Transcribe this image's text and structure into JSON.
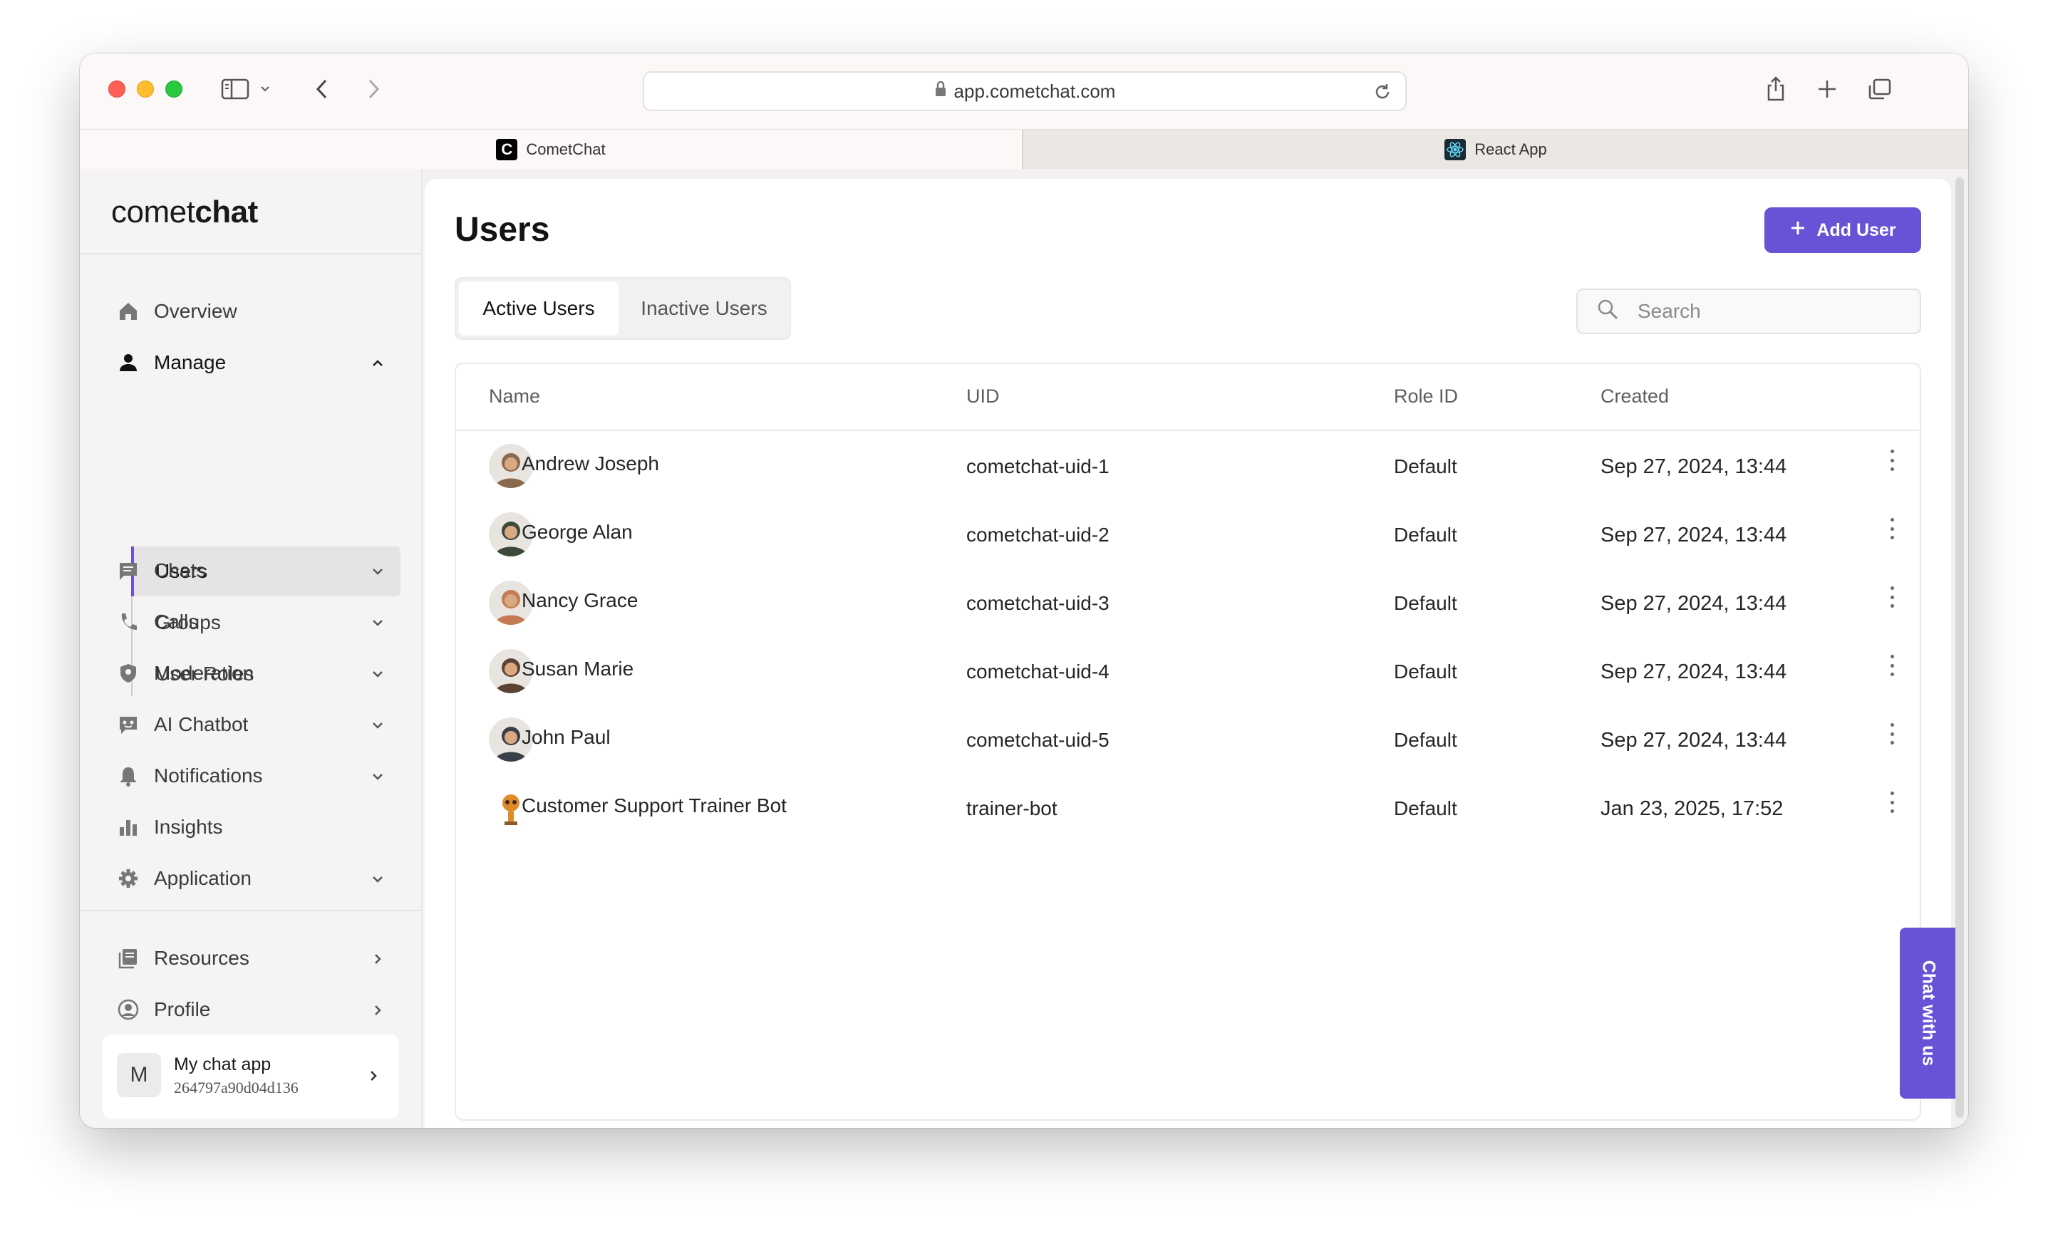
{
  "browser": {
    "url": "app.cometchat.com",
    "tabs": [
      {
        "label": "CometChat",
        "favicon": "cometchat-logo"
      },
      {
        "label": "React App",
        "favicon": "react-logo"
      }
    ]
  },
  "sidebar": {
    "logo_light": "comet",
    "logo_bold": "chat",
    "items": [
      {
        "label": "Overview",
        "icon": "home-icon"
      },
      {
        "label": "Manage",
        "icon": "person-icon"
      },
      {
        "label": "Chats",
        "icon": "chat-icon"
      },
      {
        "label": "Calls",
        "icon": "phone-icon"
      },
      {
        "label": "Moderation",
        "icon": "shield-icon"
      },
      {
        "label": "AI Chatbot",
        "icon": "bot-icon"
      },
      {
        "label": "Notifications",
        "icon": "bell-icon"
      },
      {
        "label": "Insights",
        "icon": "bar-chart-icon"
      },
      {
        "label": "Application",
        "icon": "gear-icon"
      }
    ],
    "manage_sub": [
      {
        "label": "Users",
        "active": true
      },
      {
        "label": "Groups"
      },
      {
        "label": "User Roles"
      }
    ],
    "bottom": [
      {
        "label": "Resources",
        "icon": "book-icon"
      },
      {
        "label": "Profile",
        "icon": "user-circle-icon"
      }
    ],
    "app_card": {
      "initial": "M",
      "name": "My chat app",
      "id": "264797a90d04d136"
    }
  },
  "main": {
    "title": "Users",
    "add_button": "Add User",
    "tabs": {
      "active": "Active Users",
      "inactive": "Inactive Users"
    },
    "search_placeholder": "Search",
    "columns": [
      "Name",
      "UID",
      "Role ID",
      "Created"
    ],
    "rows": [
      {
        "name": "Andrew Joseph",
        "uid": "cometchat-uid-1",
        "role": "Default",
        "created": "Sep 27, 2024, 13:44",
        "avatar_color": "#8a6a4f"
      },
      {
        "name": "George Alan",
        "uid": "cometchat-uid-2",
        "role": "Default",
        "created": "Sep 27, 2024, 13:44",
        "avatar_color": "#3d4a3a"
      },
      {
        "name": "Nancy Grace",
        "uid": "cometchat-uid-3",
        "role": "Default",
        "created": "Sep 27, 2024, 13:44",
        "avatar_color": "#c47a52"
      },
      {
        "name": "Susan Marie",
        "uid": "cometchat-uid-4",
        "role": "Default",
        "created": "Sep 27, 2024, 13:44",
        "avatar_color": "#5a4334"
      },
      {
        "name": "John Paul",
        "uid": "cometchat-uid-5",
        "role": "Default",
        "created": "Sep 27, 2024, 13:44",
        "avatar_color": "#3b3f4a"
      },
      {
        "name": "Customer Support Trainer Bot",
        "uid": "trainer-bot",
        "role": "Default",
        "created": "Jan 23, 2025, 17:52",
        "avatar_color": "#e08a2a"
      }
    ]
  },
  "chat_widget": "Chat with us",
  "colors": {
    "accent": "#6852d6"
  }
}
